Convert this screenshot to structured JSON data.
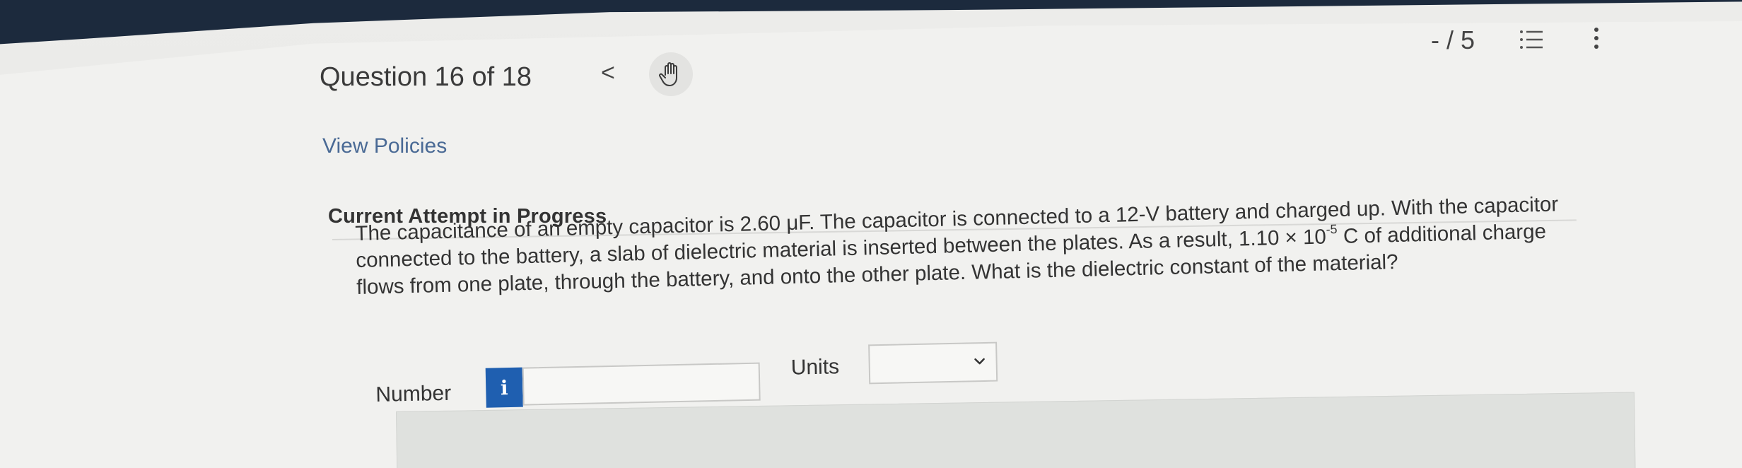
{
  "header": {
    "question_label": "Question 16 of 18",
    "prev_symbol": "<",
    "score": "- / 5",
    "icons": [
      "chevron-left-icon",
      "hand-raise-icon",
      "list-icon",
      "more-vertical-icon"
    ]
  },
  "links": {
    "view_policies": "View Policies"
  },
  "attempt": {
    "status": "Current Attempt in Progress"
  },
  "question": {
    "line1": "The capacitance of an empty capacitor is 2.60 μF. The capacitor is connected to a 12-V battery and charged up. With the capacitor",
    "line2_before_sup": "connected to the battery, a slab of dielectric material is inserted between the plates. As a result, 1.10 × 10",
    "line2_sup": "-5",
    "line2_after_sup": " C of additional charge",
    "line3": "flows from one plate, through the battery, and onto the other plate. What is the dielectric constant of the material?"
  },
  "answer": {
    "number_label": "Number",
    "info_symbol": "i",
    "number_value": "",
    "number_placeholder": "",
    "units_label": "Units",
    "units_selected": ""
  },
  "colors": {
    "topbar": "#1c2a3d",
    "link": "#4a6a95",
    "info_button": "#1f5fb0"
  }
}
